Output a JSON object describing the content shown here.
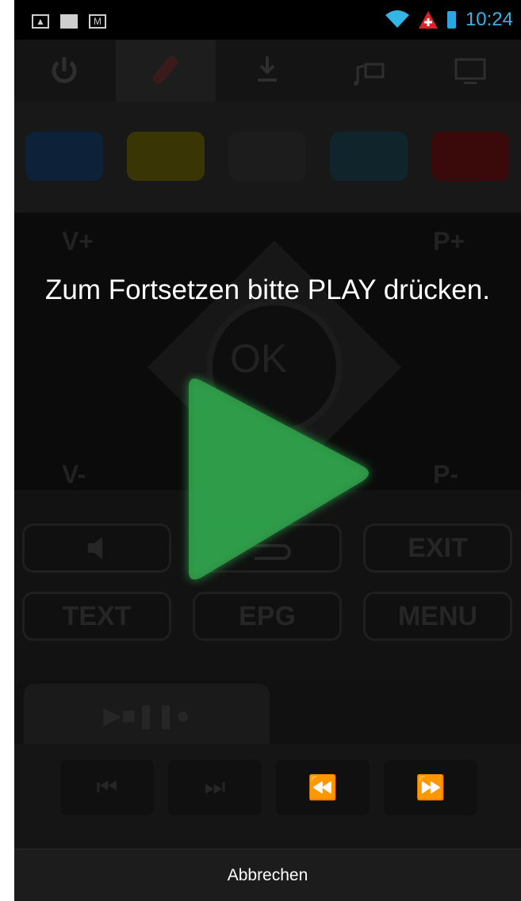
{
  "status_bar": {
    "icons_left": [
      "image-icon",
      "shopping-bag-icon",
      "gmail-icon"
    ],
    "icons_right": [
      "wifi-icon",
      "warning-icon",
      "battery-icon"
    ],
    "time": "10:24",
    "time_color": "#33b5e5"
  },
  "remote": {
    "tabs": [
      "power-icon",
      "remote-icon",
      "input-source-icon",
      "media-icon",
      "tv-icon"
    ],
    "color_buttons": [
      "#0d2238",
      "#3a3505",
      "#1c1c1c",
      "#10252b",
      "#3a0a0a"
    ],
    "volume_up": "V+",
    "volume_down": "V-",
    "program_up": "P+",
    "program_down": "P-",
    "ok_label": "OK",
    "row1": {
      "mute": "",
      "back": "",
      "exit": "EXIT"
    },
    "row2": {
      "text": "TEXT",
      "epg": "EPG",
      "menu": "MENU"
    },
    "media_tab_label": "▶■❚❚●",
    "media_buttons": [
      "⏮",
      "⏭",
      "⏪",
      "⏩"
    ]
  },
  "overlay": {
    "prompt": "Zum Fortsetzen bitte PLAY drücken.",
    "play_icon": "play-icon",
    "play_color": "#2fa04a"
  },
  "bottom_bar": {
    "cancel_label": "Abbrechen"
  }
}
